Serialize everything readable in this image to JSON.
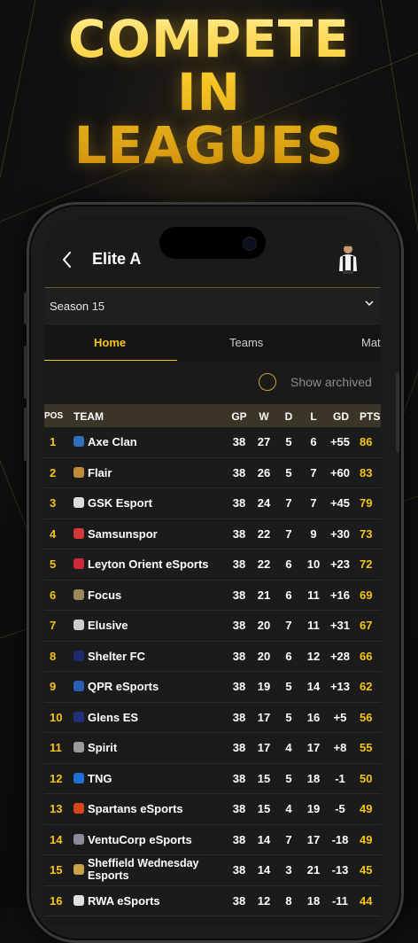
{
  "headline": [
    "COMPETE",
    "IN",
    "LEAGUES"
  ],
  "colors": {
    "accent": "#f5c518",
    "background": "#1a1a1a"
  },
  "header": {
    "back_icon": "chevron-left",
    "title": "Elite A",
    "avatar_icon": "player-avatar"
  },
  "season": {
    "selected": "Season 15",
    "icon": "chevron-down"
  },
  "tabs": [
    {
      "label": "Home",
      "active": true
    },
    {
      "label": "Teams",
      "active": false
    },
    {
      "label": "Mat",
      "active": false
    }
  ],
  "filter": {
    "show_archived_label": "Show archived",
    "checked": false
  },
  "table": {
    "columns": [
      "POS",
      "TEAM",
      "GP",
      "W",
      "D",
      "L",
      "GD",
      "PTS"
    ],
    "rows": [
      {
        "pos": "1",
        "team": "Axe Clan",
        "gp": "38",
        "w": "27",
        "d": "5",
        "l": "6",
        "gd": "+55",
        "pts": "86",
        "badge": "#2f6fbf"
      },
      {
        "pos": "2",
        "team": "Flair",
        "gp": "38",
        "w": "26",
        "d": "5",
        "l": "7",
        "gd": "+60",
        "pts": "83",
        "badge": "#c08a3a"
      },
      {
        "pos": "3",
        "team": "GSK Esport",
        "gp": "38",
        "w": "24",
        "d": "7",
        "l": "7",
        "gd": "+45",
        "pts": "79",
        "badge": "#dcdcdc"
      },
      {
        "pos": "4",
        "team": "Samsunspor",
        "gp": "38",
        "w": "22",
        "d": "7",
        "l": "9",
        "gd": "+30",
        "pts": "73",
        "badge": "#d23a3a"
      },
      {
        "pos": "5",
        "team": "Leyton Orient eSports",
        "gp": "38",
        "w": "22",
        "d": "6",
        "l": "10",
        "gd": "+23",
        "pts": "72",
        "badge": "#d0283a"
      },
      {
        "pos": "6",
        "team": "Focus",
        "gp": "38",
        "w": "21",
        "d": "6",
        "l": "11",
        "gd": "+16",
        "pts": "69",
        "badge": "#9a8a5a"
      },
      {
        "pos": "7",
        "team": "Elusive",
        "gp": "38",
        "w": "20",
        "d": "7",
        "l": "11",
        "gd": "+31",
        "pts": "67",
        "badge": "#cccccc"
      },
      {
        "pos": "8",
        "team": "Shelter FC",
        "gp": "38",
        "w": "20",
        "d": "6",
        "l": "12",
        "gd": "+28",
        "pts": "66",
        "badge": "#1d2a6b"
      },
      {
        "pos": "9",
        "team": "QPR eSports",
        "gp": "38",
        "w": "19",
        "d": "5",
        "l": "14",
        "gd": "+13",
        "pts": "62",
        "badge": "#2a5fb0"
      },
      {
        "pos": "10",
        "team": "Glens ES",
        "gp": "38",
        "w": "17",
        "d": "5",
        "l": "16",
        "gd": "+5",
        "pts": "56",
        "badge": "#1f2f7a"
      },
      {
        "pos": "11",
        "team": "Spirit",
        "gp": "38",
        "w": "17",
        "d": "4",
        "l": "17",
        "gd": "+8",
        "pts": "55",
        "badge": "#9a9a9a"
      },
      {
        "pos": "12",
        "team": "TNG",
        "gp": "38",
        "w": "15",
        "d": "5",
        "l": "18",
        "gd": "-1",
        "pts": "50",
        "badge": "#1e6fd6"
      },
      {
        "pos": "13",
        "team": "Spartans eSports",
        "gp": "38",
        "w": "15",
        "d": "4",
        "l": "19",
        "gd": "-5",
        "pts": "49",
        "badge": "#d8451f"
      },
      {
        "pos": "14",
        "team": "VentuCorp eSports",
        "gp": "38",
        "w": "14",
        "d": "7",
        "l": "17",
        "gd": "-18",
        "pts": "49",
        "badge": "#8a8a9a"
      },
      {
        "pos": "15",
        "team": "Sheffield Wednesday Esports",
        "gp": "38",
        "w": "14",
        "d": "3",
        "l": "21",
        "gd": "-13",
        "pts": "45",
        "badge": "#c9a24a"
      },
      {
        "pos": "16",
        "team": "RWA eSports",
        "gp": "38",
        "w": "12",
        "d": "8",
        "l": "18",
        "gd": "-11",
        "pts": "44",
        "badge": "#e0e0e0"
      }
    ]
  }
}
